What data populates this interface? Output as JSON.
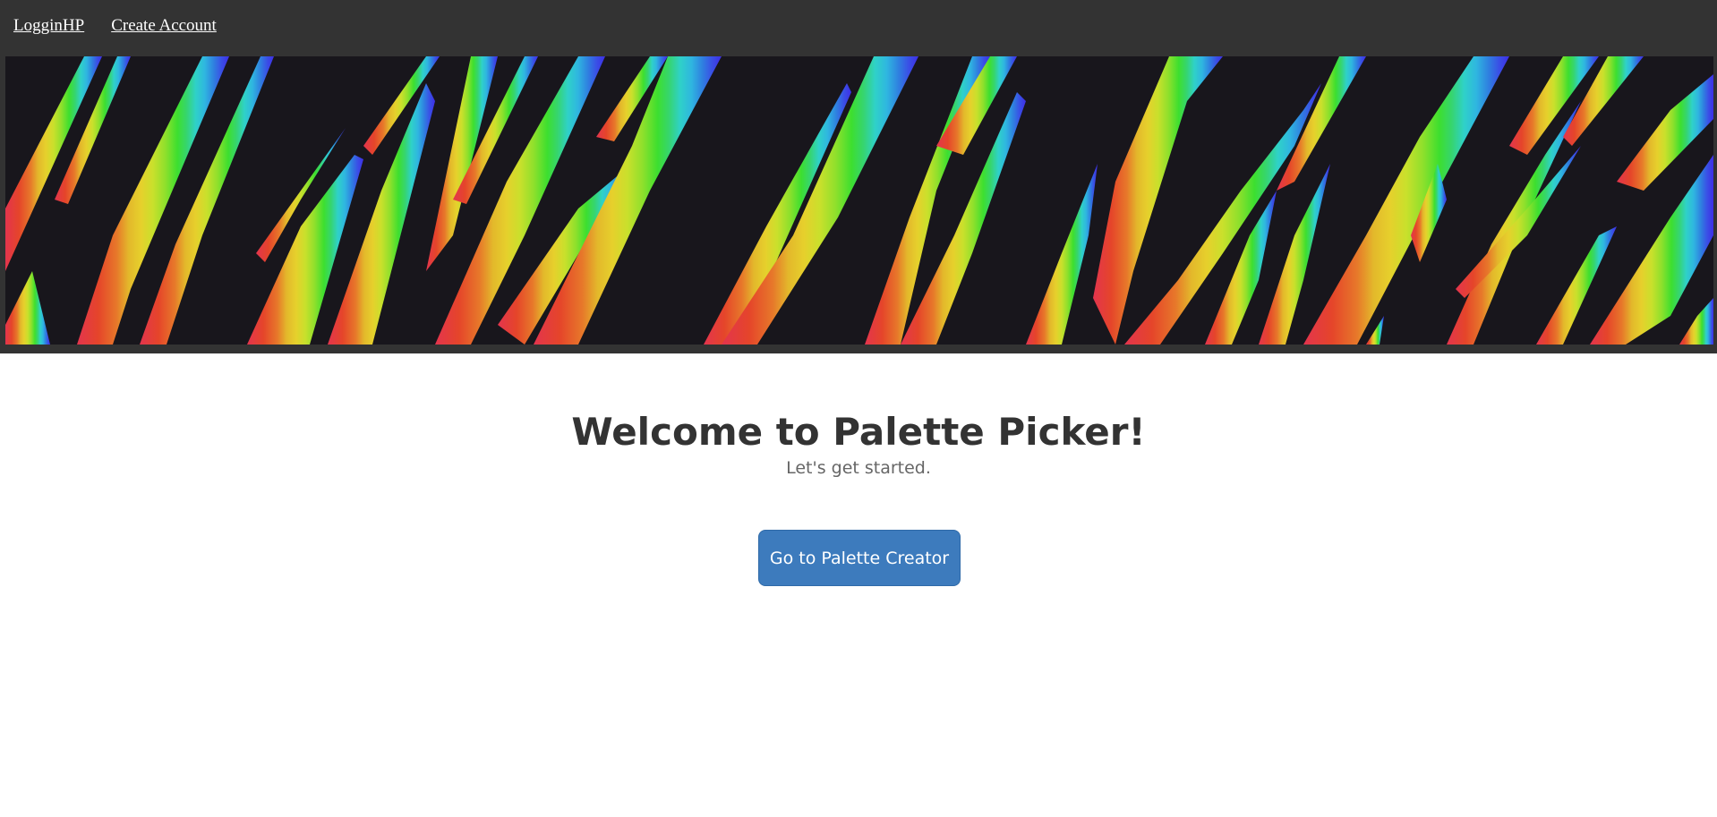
{
  "nav": {
    "links": [
      "LogginHP",
      "Create Account"
    ]
  },
  "banner": {
    "image": "rainbow-stripes-banner",
    "background_color": "#18161c",
    "stripe_colors": [
      "#e3344e",
      "#e5452a",
      "#e7782a",
      "#e3b82b",
      "#e6d02c",
      "#c9e02c",
      "#8fe02c",
      "#3ddf2f",
      "#36d56e",
      "#2fd1c8",
      "#2fb6e0",
      "#2f7fe0",
      "#3a4fe6",
      "#3e2ee6"
    ]
  },
  "hero": {
    "title": "Welcome to Palette Picker!",
    "subtitle": "Let's get started."
  },
  "actions": {
    "cta_label": "Go to Palette Creator",
    "cta_color": "#3d7bbd"
  },
  "theme": {
    "topbar_color": "#333333",
    "page_background": "#ffffff"
  }
}
